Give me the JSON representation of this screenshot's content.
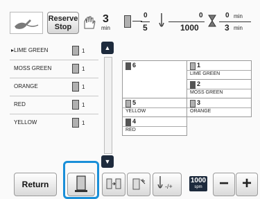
{
  "toolbar": {
    "reserve_stop": {
      "line1": "Reserve",
      "line2": "Stop"
    },
    "stop_time": {
      "value": "3",
      "unit": "min"
    },
    "thread_progress": {
      "current": "0",
      "total": "5"
    },
    "stitch_progress": {
      "current": "0",
      "total": "1000"
    },
    "time_progress": {
      "current": "0",
      "total": "3",
      "unit": "min"
    }
  },
  "thread_list": [
    {
      "name": "LIME GREEN",
      "count": "1",
      "active": true
    },
    {
      "name": "MOSS GREEN",
      "count": "1"
    },
    {
      "name": "ORANGE",
      "count": "1"
    },
    {
      "name": "RED",
      "count": "1"
    },
    {
      "name": "YELLOW",
      "count": "1"
    }
  ],
  "needles": [
    {
      "number": "6",
      "thread": ""
    },
    {
      "number": "1",
      "thread": "LIME GREEN"
    },
    {
      "number": "5",
      "thread": "YELLOW"
    },
    {
      "number": "2",
      "thread": "MOSS GREEN"
    },
    {
      "number": "4",
      "thread": "RED"
    },
    {
      "number": "3",
      "thread": "ORANGE"
    }
  ],
  "bottom": {
    "return_label": "Return",
    "speed": {
      "value": "1000",
      "unit": "spm"
    },
    "minus": "−",
    "plus": "+"
  },
  "colors": {
    "selection": "#1a8fd8",
    "dark": "#1d2a3c"
  }
}
